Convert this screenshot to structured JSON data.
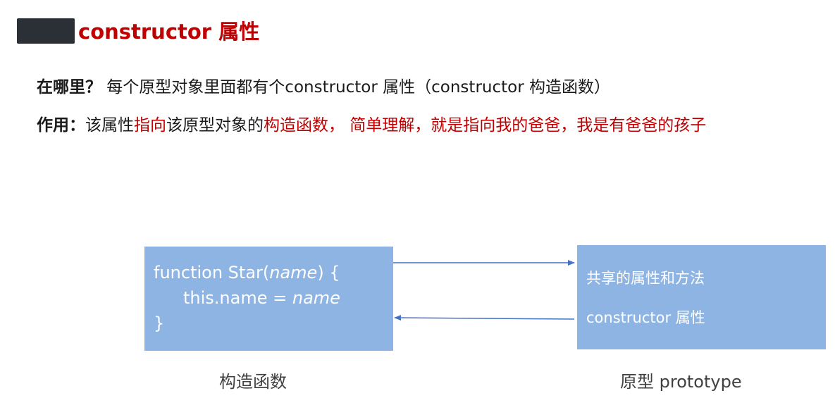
{
  "title": "constructor 属性",
  "line1": {
    "label": "在哪里？",
    "text": " 每个原型对象里面都有个constructor 属性（constructor 构造函数）"
  },
  "line2": {
    "label": "作用：",
    "seg1": "该属性",
    "seg2": "指向",
    "seg3": "该原型对象的",
    "seg4": "构造函数， 简单理解，就是指向我的爸爸，我是有爸爸的孩子"
  },
  "constructor_box": {
    "line1_prefix": "function Star(",
    "line1_param": "name",
    "line1_suffix": ") {",
    "line2_prefix": "this.name = ",
    "line2_value": "name",
    "line3": "}"
  },
  "prototype_box": {
    "line1": "共享的属性和方法",
    "line2": "constructor 属性"
  },
  "captions": {
    "left": "构造函数",
    "right": "原型 prototype"
  },
  "colors": {
    "accent_red": "#c00000",
    "box_blue": "#8eb4e3",
    "arrow_blue": "#4472c4"
  }
}
